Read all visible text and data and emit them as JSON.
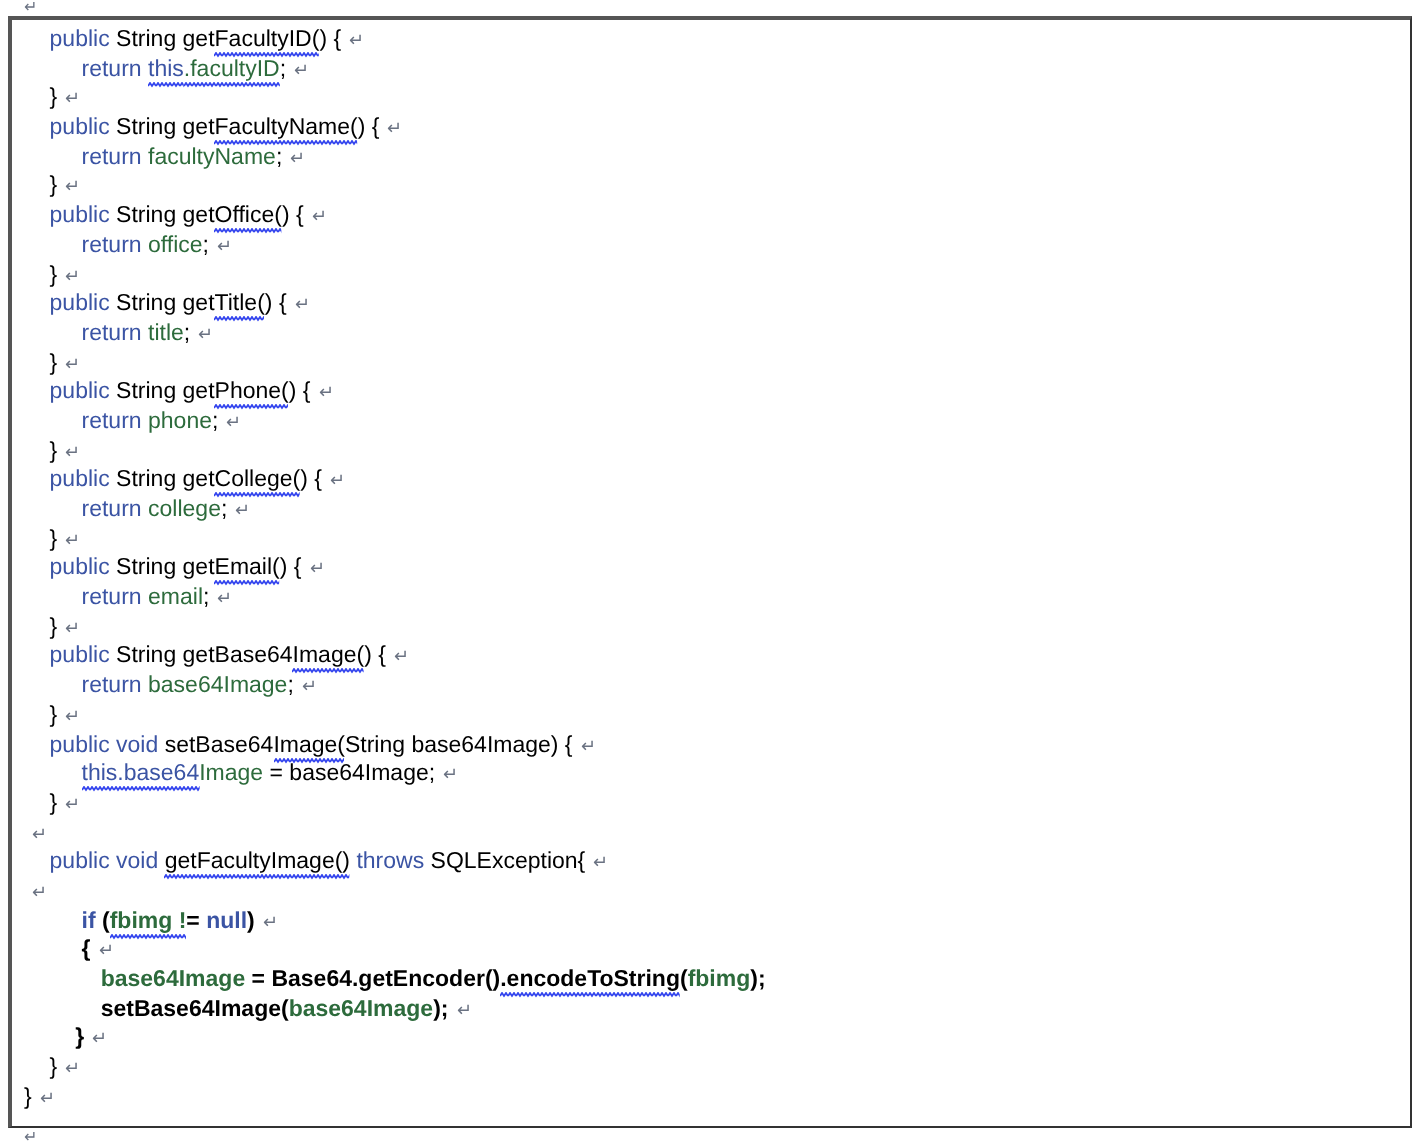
{
  "document": {
    "mark_before": "↵",
    "mark_after": "↵",
    "lines": [
      {
        "bold": false,
        "mark": "↵",
        "segments": [
          {
            "text": "    public",
            "kind": "keyword",
            "flagged": false
          },
          {
            "text": " String get",
            "kind": "plain",
            "flagged": false
          },
          {
            "text": "FacultyID(",
            "kind": "plain",
            "flagged": true
          },
          {
            "text": ") {",
            "kind": "plain",
            "flagged": false
          }
        ]
      },
      {
        "bold": false,
        "mark": "↵",
        "segments": [
          {
            "text": "         return ",
            "kind": "keyword",
            "flagged": false
          },
          {
            "text": "this",
            "kind": "keyword",
            "flagged": true
          },
          {
            "text": ".facultyID",
            "kind": "field",
            "flagged": true
          },
          {
            "text": ";",
            "kind": "plain",
            "flagged": false
          }
        ]
      },
      {
        "bold": false,
        "mark": "↵",
        "segments": [
          {
            "text": "    }",
            "kind": "plain",
            "flagged": false
          }
        ]
      },
      {
        "bold": false,
        "mark": "↵",
        "segments": [
          {
            "text": "    public",
            "kind": "keyword",
            "flagged": false
          },
          {
            "text": " String get",
            "kind": "plain",
            "flagged": false
          },
          {
            "text": "FacultyName(",
            "kind": "plain",
            "flagged": true
          },
          {
            "text": ") {",
            "kind": "plain",
            "flagged": false
          }
        ]
      },
      {
        "bold": false,
        "mark": "↵",
        "segments": [
          {
            "text": "         return ",
            "kind": "keyword",
            "flagged": false
          },
          {
            "text": "facultyName",
            "kind": "field",
            "flagged": false
          },
          {
            "text": ";",
            "kind": "plain",
            "flagged": false
          }
        ]
      },
      {
        "bold": false,
        "mark": "↵",
        "segments": [
          {
            "text": "    }",
            "kind": "plain",
            "flagged": false
          }
        ]
      },
      {
        "bold": false,
        "mark": "↵",
        "segments": [
          {
            "text": "    public",
            "kind": "keyword",
            "flagged": false
          },
          {
            "text": " String get",
            "kind": "plain",
            "flagged": false
          },
          {
            "text": "Office(",
            "kind": "plain",
            "flagged": true
          },
          {
            "text": ") {",
            "kind": "plain",
            "flagged": false
          }
        ]
      },
      {
        "bold": false,
        "mark": "↵",
        "segments": [
          {
            "text": "         return ",
            "kind": "keyword",
            "flagged": false
          },
          {
            "text": "office",
            "kind": "field",
            "flagged": false
          },
          {
            "text": ";",
            "kind": "plain",
            "flagged": false
          }
        ]
      },
      {
        "bold": false,
        "mark": "↵",
        "segments": [
          {
            "text": "    }",
            "kind": "plain",
            "flagged": false
          }
        ]
      },
      {
        "bold": false,
        "mark": "↵",
        "segments": [
          {
            "text": "    public",
            "kind": "keyword",
            "flagged": false
          },
          {
            "text": " String get",
            "kind": "plain",
            "flagged": false
          },
          {
            "text": "Title(",
            "kind": "plain",
            "flagged": true
          },
          {
            "text": ") {",
            "kind": "plain",
            "flagged": false
          }
        ]
      },
      {
        "bold": false,
        "mark": "↵",
        "segments": [
          {
            "text": "         return ",
            "kind": "keyword",
            "flagged": false
          },
          {
            "text": "title",
            "kind": "field",
            "flagged": false
          },
          {
            "text": ";",
            "kind": "plain",
            "flagged": false
          }
        ]
      },
      {
        "bold": false,
        "mark": "↵",
        "segments": [
          {
            "text": "    }",
            "kind": "plain",
            "flagged": false
          }
        ]
      },
      {
        "bold": false,
        "mark": "↵",
        "segments": [
          {
            "text": "    public",
            "kind": "keyword",
            "flagged": false
          },
          {
            "text": " String get",
            "kind": "plain",
            "flagged": false
          },
          {
            "text": "Phone(",
            "kind": "plain",
            "flagged": true
          },
          {
            "text": ") {",
            "kind": "plain",
            "flagged": false
          }
        ]
      },
      {
        "bold": false,
        "mark": "↵",
        "segments": [
          {
            "text": "         return ",
            "kind": "keyword",
            "flagged": false
          },
          {
            "text": "phone",
            "kind": "field",
            "flagged": false
          },
          {
            "text": ";",
            "kind": "plain",
            "flagged": false
          }
        ]
      },
      {
        "bold": false,
        "mark": "↵",
        "segments": [
          {
            "text": "    }",
            "kind": "plain",
            "flagged": false
          }
        ]
      },
      {
        "bold": false,
        "mark": "↵",
        "segments": [
          {
            "text": "    public",
            "kind": "keyword",
            "flagged": false
          },
          {
            "text": " String get",
            "kind": "plain",
            "flagged": false
          },
          {
            "text": "College(",
            "kind": "plain",
            "flagged": true
          },
          {
            "text": ") {",
            "kind": "plain",
            "flagged": false
          }
        ]
      },
      {
        "bold": false,
        "mark": "↵",
        "segments": [
          {
            "text": "         return ",
            "kind": "keyword",
            "flagged": false
          },
          {
            "text": "college",
            "kind": "field",
            "flagged": false
          },
          {
            "text": ";",
            "kind": "plain",
            "flagged": false
          }
        ]
      },
      {
        "bold": false,
        "mark": "↵",
        "segments": [
          {
            "text": "    }",
            "kind": "plain",
            "flagged": false
          }
        ]
      },
      {
        "bold": false,
        "mark": "↵",
        "segments": [
          {
            "text": "    public",
            "kind": "keyword",
            "flagged": false
          },
          {
            "text": " String get",
            "kind": "plain",
            "flagged": false
          },
          {
            "text": "Email(",
            "kind": "plain",
            "flagged": true
          },
          {
            "text": ") {",
            "kind": "plain",
            "flagged": false
          }
        ]
      },
      {
        "bold": false,
        "mark": "↵",
        "segments": [
          {
            "text": "         return ",
            "kind": "keyword",
            "flagged": false
          },
          {
            "text": "email",
            "kind": "field",
            "flagged": false
          },
          {
            "text": ";",
            "kind": "plain",
            "flagged": false
          }
        ]
      },
      {
        "bold": false,
        "mark": "↵",
        "segments": [
          {
            "text": "    }",
            "kind": "plain",
            "flagged": false
          }
        ]
      },
      {
        "bold": false,
        "mark": "↵",
        "segments": [
          {
            "text": "    public",
            "kind": "keyword",
            "flagged": false
          },
          {
            "text": " String getBase64",
            "kind": "plain",
            "flagged": false
          },
          {
            "text": "Image(",
            "kind": "plain",
            "flagged": true
          },
          {
            "text": ") {",
            "kind": "plain",
            "flagged": false
          }
        ]
      },
      {
        "bold": false,
        "mark": "↵",
        "segments": [
          {
            "text": "         return ",
            "kind": "keyword",
            "flagged": false
          },
          {
            "text": "base64Image",
            "kind": "field",
            "flagged": false
          },
          {
            "text": ";",
            "kind": "plain",
            "flagged": false
          }
        ]
      },
      {
        "bold": false,
        "mark": "↵",
        "segments": [
          {
            "text": "    }",
            "kind": "plain",
            "flagged": false
          }
        ]
      },
      {
        "bold": false,
        "mark": "↵",
        "segments": [
          {
            "text": "    public void",
            "kind": "keyword",
            "flagged": false
          },
          {
            "text": " setBase64",
            "kind": "plain",
            "flagged": false
          },
          {
            "text": "Image(",
            "kind": "plain",
            "flagged": true
          },
          {
            "text": "String base64Image) {",
            "kind": "plain",
            "flagged": false
          }
        ]
      },
      {
        "bold": false,
        "mark": "↵",
        "segments": [
          {
            "text": "         this.base64",
            "kind": "keyword",
            "flagged": true
          },
          {
            "text": "Image",
            "kind": "field",
            "flagged": false
          },
          {
            "text": " = base64Image;",
            "kind": "plain",
            "flagged": false
          }
        ]
      },
      {
        "bold": false,
        "mark": "↵",
        "segments": [
          {
            "text": "    }",
            "kind": "plain",
            "flagged": false
          }
        ]
      },
      {
        "mark": "↵"
      },
      {
        "bold": false,
        "mark": "↵",
        "segments": [
          {
            "text": "    public void ",
            "kind": "keyword",
            "flagged": false
          },
          {
            "text": "getFacultyImage()",
            "kind": "plain",
            "flagged": true
          },
          {
            "text": " throws",
            "kind": "keyword",
            "flagged": false
          },
          {
            "text": " SQLException{",
            "kind": "plain",
            "flagged": false
          }
        ]
      },
      {
        "mark": "↵"
      },
      {
        "bold": true,
        "mark": "↵",
        "segments": [
          {
            "text": "         if ",
            "kind": "keyword",
            "flagged": false
          },
          {
            "text": "(",
            "kind": "plain",
            "flagged": false
          },
          {
            "text": "fbimg !",
            "kind": "field",
            "flagged": true
          },
          {
            "text": "= ",
            "kind": "plain",
            "flagged": false
          },
          {
            "text": "null",
            "kind": "keyword",
            "flagged": false
          },
          {
            "text": ")",
            "kind": "plain",
            "flagged": false
          }
        ]
      },
      {
        "bold": true,
        "mark": "↵",
        "segments": [
          {
            "text": "         {",
            "kind": "plain",
            "flagged": false
          }
        ]
      },
      {
        "bold": true,
        "segments": [
          {
            "text": "            base64Image",
            "kind": "field",
            "flagged": false
          },
          {
            "text": " = Base64.getEncoder()",
            "kind": "plain",
            "flagged": false
          },
          {
            "text": ".encodeToString",
            "kind": "plain",
            "flagged": true
          },
          {
            "text": "(",
            "kind": "plain",
            "flagged": false
          },
          {
            "text": "fbimg",
            "kind": "field",
            "flagged": false
          },
          {
            "text": ");",
            "kind": "plain",
            "flagged": false
          }
        ]
      },
      {
        "bold": true,
        "mark": "↵",
        "segments": [
          {
            "text": "            setBase64Image(",
            "kind": "plain",
            "flagged": false
          },
          {
            "text": "base64Image",
            "kind": "field",
            "flagged": false
          },
          {
            "text": ");",
            "kind": "plain",
            "flagged": false
          }
        ]
      },
      {
        "bold": true,
        "mark": "↵",
        "segments": [
          {
            "text": "        }",
            "kind": "plain",
            "flagged": false
          }
        ]
      },
      {
        "bold": false,
        "mark": "↵",
        "segments": [
          {
            "text": "    }",
            "kind": "plain",
            "flagged": false
          }
        ]
      },
      {
        "bold": false,
        "mark": "↵",
        "segments": [
          {
            "text": "}",
            "kind": "plain",
            "flagged": false
          }
        ]
      }
    ]
  }
}
